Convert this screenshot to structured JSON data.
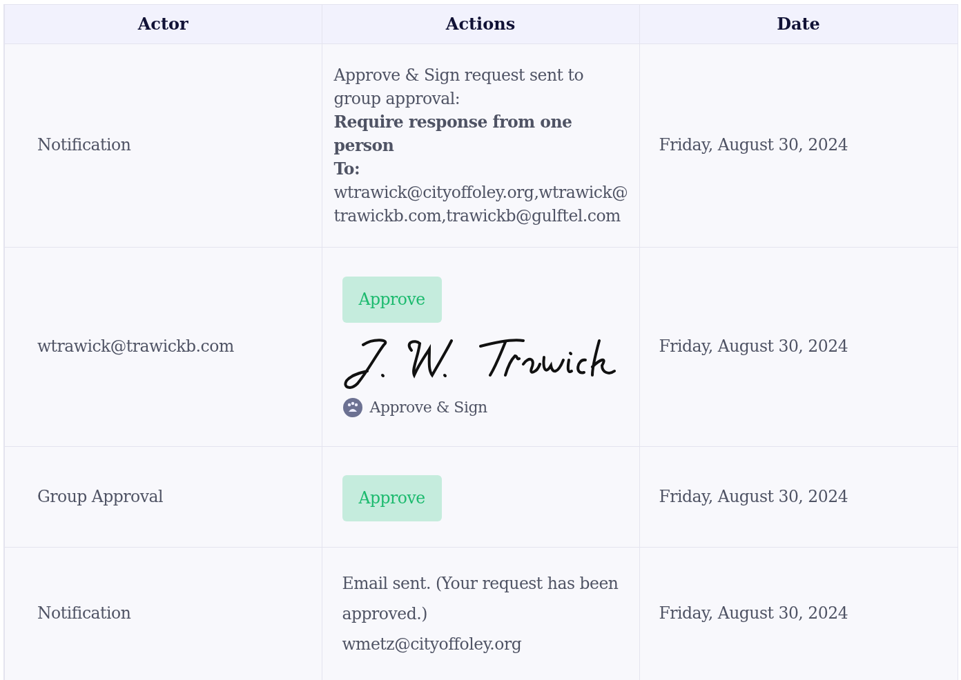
{
  "table": {
    "columns": [
      "Actor",
      "Actions",
      "Date"
    ],
    "rows": [
      {
        "actor": "Notification",
        "date": "Friday, August 30, 2024",
        "actions": [
          {
            "kind": "text",
            "bold": false,
            "text": "Approve & Sign request sent to group approval:"
          },
          {
            "kind": "text",
            "bold": true,
            "text": "Require response from one person"
          },
          {
            "kind": "text",
            "bold": true,
            "text": "To:"
          },
          {
            "kind": "text",
            "bold": false,
            "text": "wtrawick@cityoffoley.org,wtrawick@trawickb.com,trawickb@gulftel.com"
          }
        ]
      },
      {
        "actor": "wtrawick@trawickb.com",
        "date": "Friday, August 30, 2024",
        "actions": [
          {
            "kind": "badge",
            "text": "Approve"
          },
          {
            "kind": "signature"
          },
          {
            "kind": "signed_by",
            "text": "Approve & Sign"
          }
        ]
      },
      {
        "actor": "Group Approval",
        "date": "Friday, August 30, 2024",
        "actions": [
          {
            "kind": "badge",
            "text": "Approve"
          }
        ]
      },
      {
        "actor": "Notification",
        "date": "Friday, August 30, 2024",
        "actions": [
          {
            "kind": "note",
            "text": "Email sent. (Your request has been approved.)"
          },
          {
            "kind": "note",
            "text": "wmetz@cityoffoley.org"
          }
        ]
      }
    ]
  }
}
